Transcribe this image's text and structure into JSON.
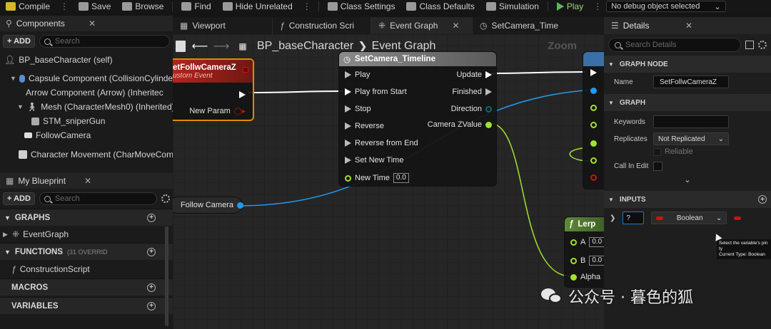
{
  "toolbar": {
    "compile": "Compile",
    "save": "Save",
    "browse": "Browse",
    "find": "Find",
    "hide_unrelated": "Hide Unrelated",
    "class_settings": "Class Settings",
    "class_defaults": "Class Defaults",
    "simulation": "Simulation",
    "play": "Play",
    "debug_object": "No debug object selected"
  },
  "components": {
    "tab": "Components",
    "add": "+ ADD",
    "search_placeholder": "Search",
    "items": [
      "BP_baseCharacter (self)",
      "Capsule Component (CollisionCylinde",
      "Arrow Component (Arrow) (Inheritec",
      "Mesh (CharacterMesh0) (Inherited)",
      "STM_sniperGun",
      "FollowCamera",
      "Character Movement (CharMoveComp"
    ]
  },
  "my_blueprint": {
    "tab": "My Blueprint",
    "add": "+ ADD",
    "search_placeholder": "Search",
    "graphs": "GRAPHS",
    "event_graph": "EventGraph",
    "functions": "FUNCTIONS",
    "functions_sub": "(31 OVERRID",
    "construction_script": "ConstructionScript",
    "macros": "MACROS",
    "variables": "VARIABLES"
  },
  "graph_tabs": [
    "Viewport",
    "Construction Scri",
    "Event Graph",
    "SetCamera_Time"
  ],
  "graph": {
    "breadcrumb_root": "BP_baseCharacter",
    "breadcrumb_leaf": "Event Graph",
    "zoom": "Zoom",
    "custom_event": {
      "title": "etFollwCameraZ",
      "subtitle": "ustom Event",
      "new_param": "New Param"
    },
    "timeline": {
      "title": "SetCamera_Timeline",
      "inputs": [
        "Play",
        "Play from Start",
        "Stop",
        "Reverse",
        "Reverse from End",
        "Set New Time",
        "New Time"
      ],
      "new_time_value": "0.0",
      "outputs": [
        "Update",
        "Finished",
        "Direction",
        "Camera ZValue"
      ]
    },
    "follow_camera": "Follow Camera",
    "lerp": {
      "title": "Lerp",
      "a": "A",
      "b": "B",
      "alpha": "Alpha",
      "a_val": "0.0",
      "b_val": "0.0"
    }
  },
  "details": {
    "tab": "Details",
    "search_placeholder": "Search Details",
    "graph_node": "GRAPH NODE",
    "name_label": "Name",
    "name_value": "SetFollwCameraZ",
    "graph_section": "GRAPH",
    "keywords_label": "Keywords",
    "replicates_label": "Replicates",
    "replicates_value": "Not Replicated",
    "reliable": "Reliable",
    "call_in_edit": "Call In Edit",
    "inputs_section": "INPUTS",
    "input_name": "?",
    "input_type": "Boolean",
    "tooltip_line1": "Select the variable's pin ty",
    "tooltip_line2": "Current Type: Boolean"
  },
  "watermark": "公众号 · 暮色的狐",
  "colors": {
    "exec": "#ffffff",
    "object_pin": "#1e9bf0",
    "float_pin": "#9fe32e",
    "bool_pin": "#d01010",
    "custom_event_header": "#b8241d",
    "timeline_header": "#7a7a7a",
    "lerp_header": "#5e8a3a"
  }
}
